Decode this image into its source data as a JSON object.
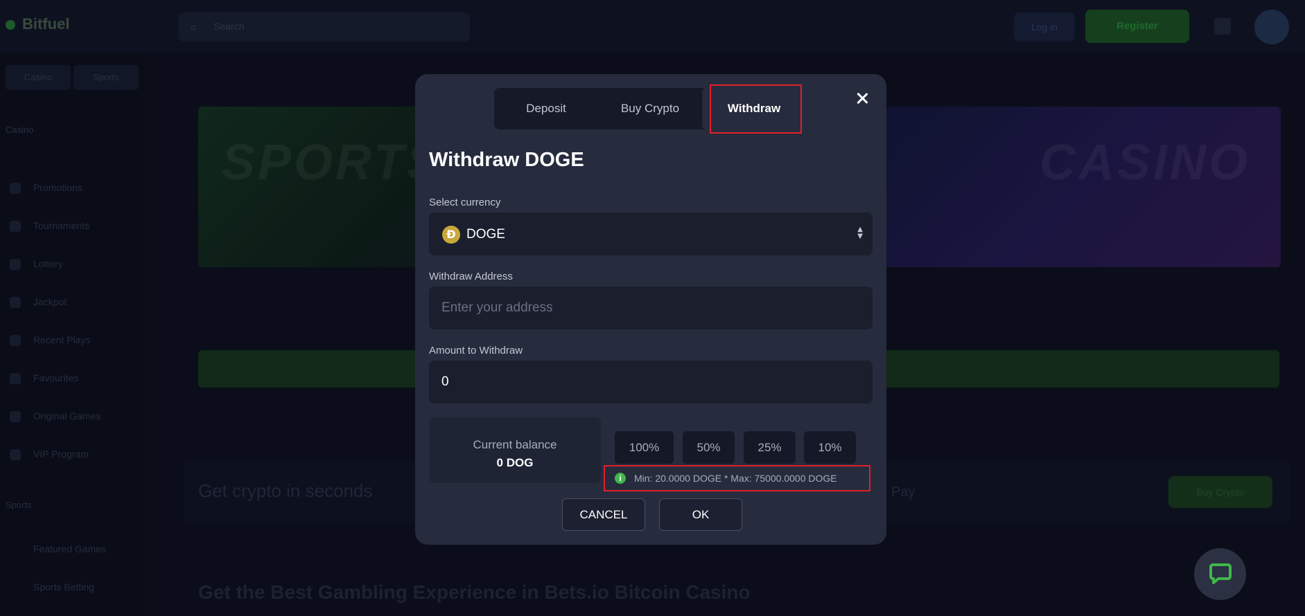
{
  "background": {
    "logo": "Bitfuel",
    "search_placeholder": "Search",
    "login_label": "Log in",
    "register_label": "Register",
    "sidebar_tabs": [
      "Casino",
      "Sports"
    ],
    "sidebar_head": "Casino",
    "sidebar_items": [
      "Promotions",
      "Tournaments",
      "Lottery",
      "Jackpot",
      "Recent Plays",
      "Favourites",
      "Original Games",
      "VIP Program"
    ],
    "sidebar_foot_head": "Sports",
    "sidebar_foot_items": [
      "Featured Games",
      "Sports Betting"
    ],
    "banner_sports": "SPORTS",
    "banner_casino": "CASINO",
    "promo_text": "Get crypto in seconds",
    "promo_pay": "Pay",
    "promo_button": "Buy Crypto",
    "bottom_heading": "Get the Best Gambling Experience in Bets.io Bitcoin Casino"
  },
  "modal": {
    "tabs": [
      "Deposit",
      "Buy Crypto",
      "Withdraw"
    ],
    "active_tab": "Withdraw",
    "title": "Withdraw DOGE",
    "currency_label": "Select currency",
    "currency_value": "DOGE",
    "currency_icon": "doge-coin-icon",
    "address_label": "Withdraw Address",
    "address_placeholder": "Enter your address",
    "amount_label": "Amount to Withdraw",
    "amount_value": "0",
    "balance_title": "Current balance",
    "balance_value": "0 DOG",
    "percent_buttons": [
      "100%",
      "50%",
      "25%",
      "10%"
    ],
    "limits_text": "Min: 20.0000 DOGE * Max: 75000.0000 DOGE",
    "cancel_label": "CANCEL",
    "ok_label": "OK"
  },
  "colors": {
    "modal_bg": "#262b3d",
    "accent_green": "#3fb84b",
    "highlight_red": "#e21f2a"
  }
}
